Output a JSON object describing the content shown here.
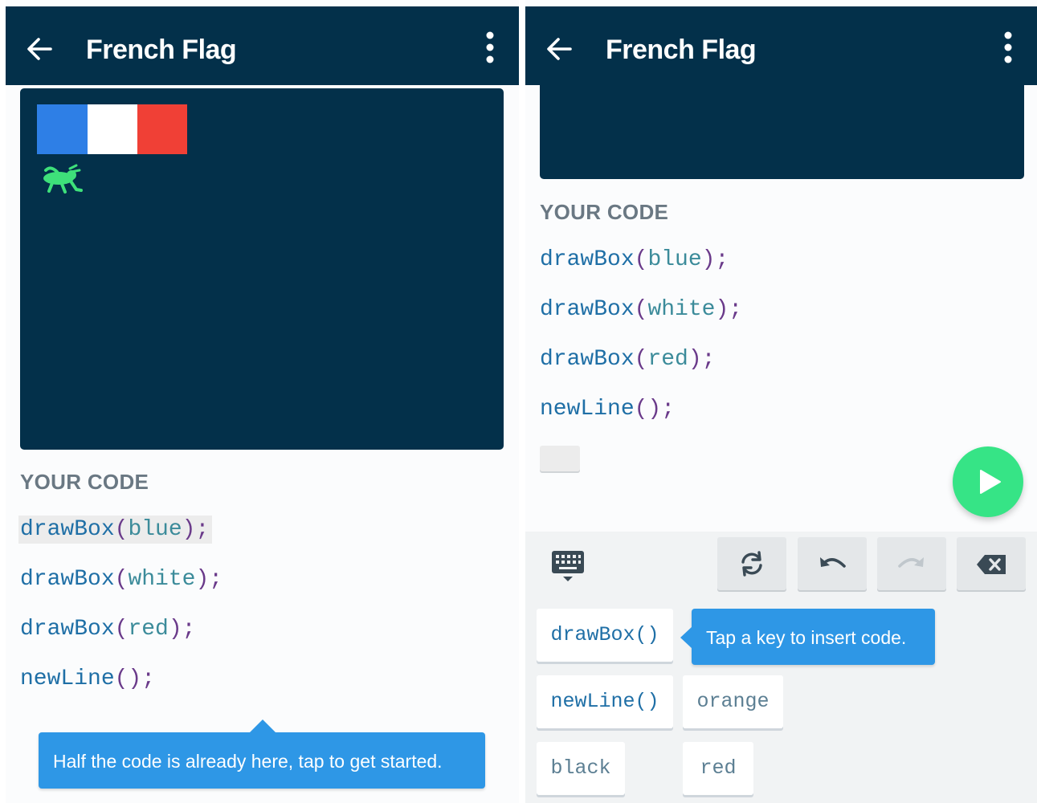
{
  "colors": {
    "appbar": "#03304a",
    "flag_blue": "#2e7fe6",
    "flag_white": "#ffffff",
    "flag_red": "#f04036",
    "grasshopper": "#3ee07a",
    "play": "#36e486",
    "tooltip": "#2e97e6"
  },
  "left": {
    "appbar": {
      "title": "French Flag",
      "back_icon": "arrow-left-icon",
      "menu_icon": "more-vert-icon"
    },
    "canvas": {
      "flag_stripes": [
        "blue",
        "white",
        "red"
      ],
      "sprite_icon": "grasshopper-icon"
    },
    "section_title": "YOUR CODE",
    "code": [
      {
        "fn": "drawBox",
        "arg": "blue",
        "highlighted": true
      },
      {
        "fn": "drawBox",
        "arg": "white",
        "highlighted": false
      },
      {
        "fn": "drawBox",
        "arg": "red",
        "highlighted": false
      },
      {
        "fn": "newLine",
        "arg": "",
        "highlighted": false
      }
    ],
    "tooltip": "Half the code is already here, tap to get started."
  },
  "right": {
    "appbar": {
      "title": "French Flag",
      "back_icon": "arrow-left-icon",
      "menu_icon": "more-vert-icon"
    },
    "section_title": "YOUR CODE",
    "code": [
      {
        "fn": "drawBox",
        "arg": "blue"
      },
      {
        "fn": "drawBox",
        "arg": "white"
      },
      {
        "fn": "drawBox",
        "arg": "red"
      },
      {
        "fn": "newLine",
        "arg": ""
      }
    ],
    "play_icon": "play-icon",
    "toolbar": {
      "keyboard_icon": "keyboard-icon",
      "refresh_icon": "refresh-icon",
      "undo_icon": "undo-icon",
      "redo_icon": "redo-icon",
      "backspace_icon": "backspace-icon"
    },
    "keys": [
      {
        "label": "drawBox()",
        "kind": "fn"
      },
      {
        "label": "newLine()",
        "kind": "fn"
      },
      {
        "label": "orange",
        "kind": "arg"
      },
      {
        "label": "black",
        "kind": "arg"
      },
      {
        "label": "red",
        "kind": "arg"
      }
    ],
    "tooltip": "Tap a key to insert code."
  }
}
